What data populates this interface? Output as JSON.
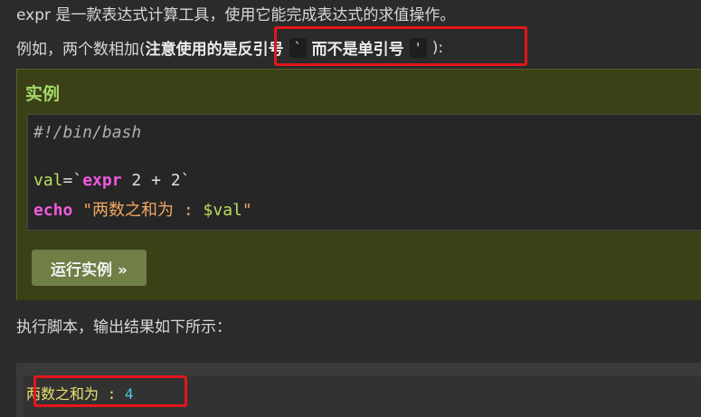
{
  "intro": {
    "line1": "expr 是一款表达式计算工具，使用它能完成表达式的求值操作。",
    "line2_prefix": "例如，两个数相加(",
    "line2_bold1": "注意使用的是",
    "line2_bold2": "反引号",
    "backtick": "`",
    "line2_bold3": "而不是单引号",
    "quote": "'",
    "line2_suffix": "):"
  },
  "example": {
    "title": "实例",
    "code": {
      "line1": "#!/bin/bash",
      "line3_var": "val",
      "line3_op1": "=`",
      "line3_kw": "expr",
      "line3_rest": " 2 + 2`",
      "line4_kw": "echo",
      "line4_str1": " \"两数之和为 : ",
      "line4_dollar": "$val",
      "line4_str2": "\""
    },
    "run_button": "运行实例 »"
  },
  "after": {
    "text": "执行脚本，输出结果如下所示："
  },
  "output": {
    "label": "两数之和为 : ",
    "value": "4"
  },
  "colors": {
    "highlight_border": "#e4161b",
    "example_bg": "#3b4017",
    "run_button_bg": "#6f7f46"
  }
}
